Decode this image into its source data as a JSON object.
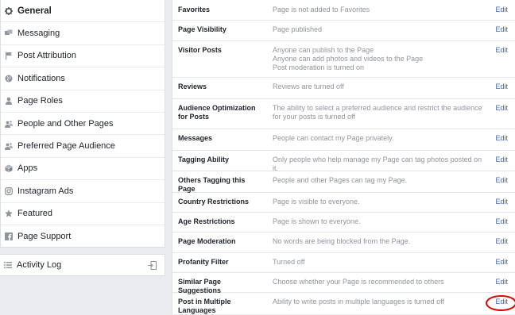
{
  "sidebar": {
    "items": [
      {
        "label": "General",
        "icon": "gear-icon",
        "active": true
      },
      {
        "label": "Messaging",
        "icon": "messaging-icon"
      },
      {
        "label": "Post Attribution",
        "icon": "flag-icon"
      },
      {
        "label": "Notifications",
        "icon": "globe-icon"
      },
      {
        "label": "Page Roles",
        "icon": "person-icon"
      },
      {
        "label": "People and Other Pages",
        "icon": "people-icon"
      },
      {
        "label": "Preferred Page Audience",
        "icon": "people-icon"
      },
      {
        "label": "Apps",
        "icon": "cube-icon"
      },
      {
        "label": "Instagram Ads",
        "icon": "instagram-icon"
      },
      {
        "label": "Featured",
        "icon": "star-icon"
      },
      {
        "label": "Page Support",
        "icon": "facebook-icon"
      }
    ],
    "activity_log": {
      "label": "Activity Log",
      "icon": "list-icon"
    }
  },
  "settings": {
    "edit_label": "Edit",
    "rows": [
      {
        "label": "Favorites",
        "value": "Page is not added to Favorites"
      },
      {
        "label": "Page Visibility",
        "value": "Page published"
      },
      {
        "label": "Visitor Posts",
        "value": "Anyone can publish to the Page\nAnyone can add photos and videos to the Page\nPost moderation is turned on"
      },
      {
        "label": "Reviews",
        "value": "Reviews are turned off"
      },
      {
        "label": "Audience Optimization for Posts",
        "value": "The ability to select a preferred audience and restrict the audience for your posts is turned off"
      },
      {
        "label": "Messages",
        "value": "People can contact my Page privately."
      },
      {
        "label": "Tagging Ability",
        "value": "Only people who help manage my Page can tag photos posted on it."
      },
      {
        "label": "Others Tagging this Page",
        "value": "People and other Pages can tag my Page."
      },
      {
        "label": "Country Restrictions",
        "value": "Page is visible to everyone."
      },
      {
        "label": "Age Restrictions",
        "value": "Page is shown to everyone."
      },
      {
        "label": "Page Moderation",
        "value": "No words are being blocked from the Page."
      },
      {
        "label": "Profanity Filter",
        "value": "Turned off"
      },
      {
        "label": "Similar Page Suggestions",
        "value": "Choose whether your Page is recommended to others"
      },
      {
        "label": "Post in Multiple Languages",
        "value": "Ability to write posts in multiple languages is turned off"
      }
    ]
  },
  "colors": {
    "link": "#4267b2",
    "highlight": "#e00000",
    "muted": "#90949c"
  }
}
